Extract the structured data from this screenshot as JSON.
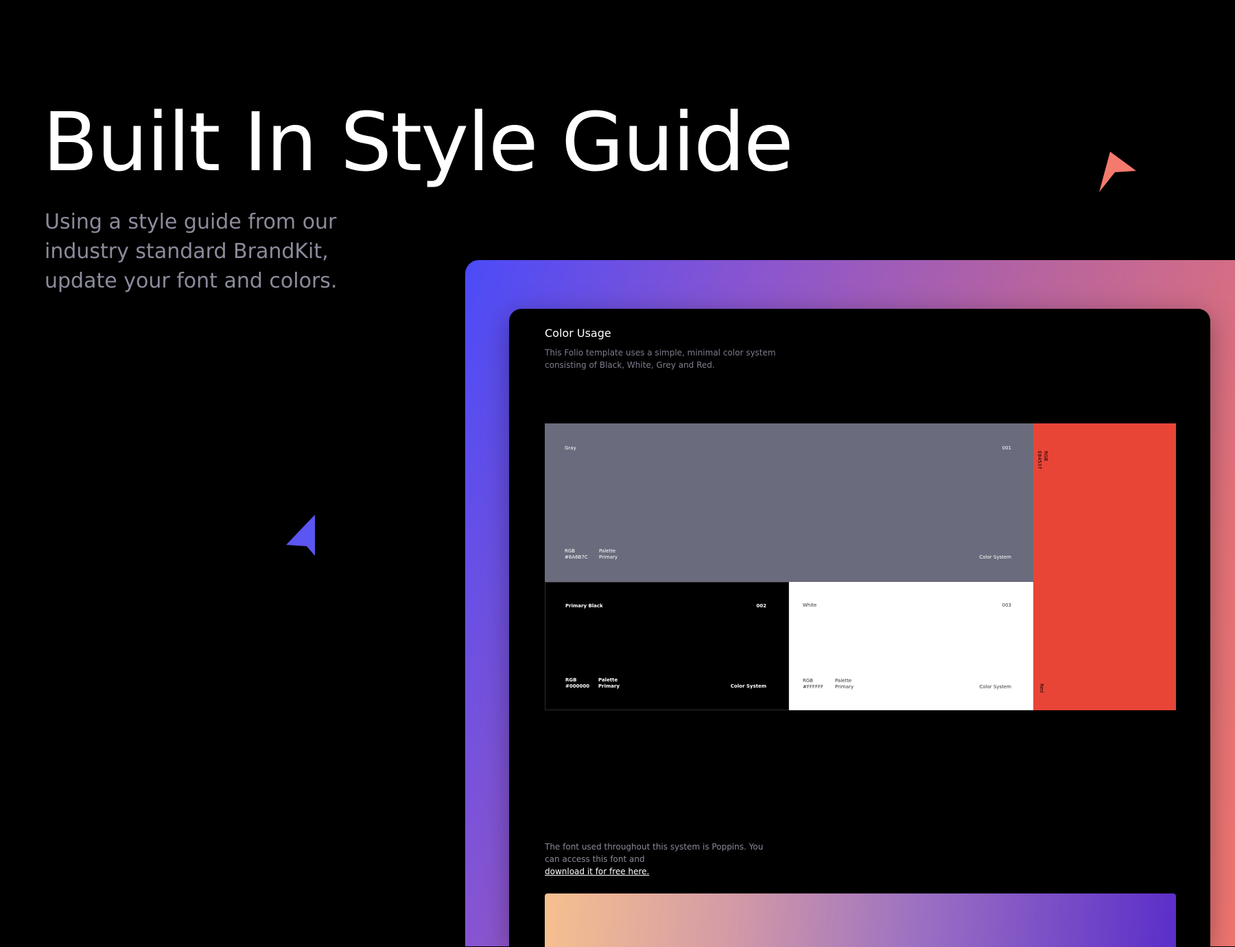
{
  "hero": {
    "title": "Built In Style Guide",
    "subtitle_lines": [
      "Using a style guide from our",
      "industry standard BrandKit,",
      "update your font and colors."
    ]
  },
  "colors": {
    "accent_coral": "#f47a6e",
    "accent_blue": "#5b55f2",
    "gradient_start": "#4b4bf8",
    "gradient_end": "#f07670"
  },
  "doc": {
    "title": "Color Usage",
    "description_lines": [
      "This Folio template uses a simple, minimal color system",
      "consisting of Black, White, Grey and Red."
    ],
    "swatches": {
      "gray": {
        "name": "Gray",
        "number": "001",
        "rgb_label": "RGB",
        "rgb_value": "#6A6B7C",
        "palette_label": "Palette",
        "palette_value": "Primary",
        "system": "Color System",
        "color": "#6a6b7c"
      },
      "black": {
        "name": "Primary Black",
        "number": "002",
        "rgb_label": "RGB",
        "rgb_value": "#000000",
        "palette_label": "Palette",
        "palette_value": "Primary",
        "system": "Color System",
        "color": "#000000"
      },
      "white": {
        "name": "White",
        "number": "003",
        "rgb_label": "RGB",
        "rgb_value": "#FFFFFF",
        "palette_label": "Palette",
        "palette_value": "Primary",
        "system": "Color System",
        "color": "#ffffff"
      },
      "red": {
        "name": "Red",
        "rgb_label": "RGB",
        "rgb_value": "E84537",
        "color": "#e84537"
      }
    },
    "font_note": {
      "line1": "The font used throughout this system is Poppins. You",
      "line2_prefix": "can access this font and ",
      "link_text": "download it for free here."
    }
  }
}
